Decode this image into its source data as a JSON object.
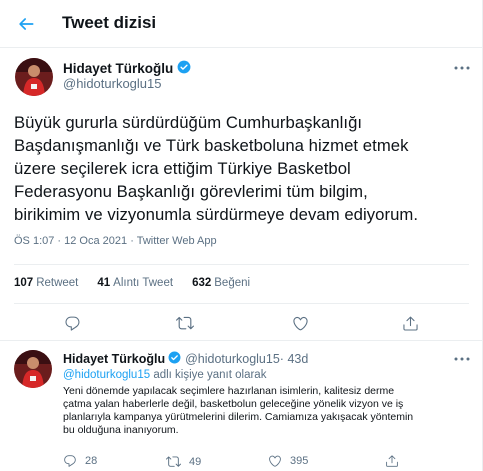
{
  "header": {
    "title": "Tweet dizisi"
  },
  "main_tweet": {
    "author_name": "Hidayet Türkoğlu",
    "author_handle": "@hidoturkoglu15",
    "text": "Büyük gururla sürdürdüğüm Cumhurbaşkanlığı\nBaşdanışmanlığı ve Türk basketboluna hizmet etmek\nüzere seçilerek icra ettiğim Türkiye Basketbol\nFederasyonu Başkanlığı görevlerimi tüm bilgim,\nbirikimim ve vizyonumla sürdürmeye devam ediyorum.",
    "time": "ÖS 1:07",
    "date": "12 Oca 2021",
    "source": "Twitter Web App",
    "stats": {
      "retweets_count": "107",
      "retweets_label": "Retweet",
      "quotes_count": "41",
      "quotes_label": "Alıntı Tweet",
      "likes_count": "632",
      "likes_label": "Beğeni"
    }
  },
  "reply_tweet": {
    "author_name": "Hidayet Türkoğlu",
    "author_handle": "@hidoturkoglu15",
    "time": "43d",
    "reply_to_mention": "@hidoturkoglu15",
    "reply_to_suffix": " adlı kişiye yanıt olarak",
    "text": "Yeni dönemde yapılacak seçimlere hazırlanan isimlerin, kalitesiz derme\nçatma yalan haberlerle değil, basketbolun geleceğine yönelik vizyon ve iş\nplanlarıyla kampanya yürütmelerini dilerim. Camiamıza yakışacak yöntemin\nbu olduğuna inanıyorum.",
    "reply_count": "28",
    "retweet_count": "49",
    "like_count": "395"
  },
  "colors": {
    "accent": "#1da1f2",
    "muted": "#5b7083",
    "divider": "#ebeef0",
    "text": "#0f1419"
  },
  "icons": [
    "back-arrow-icon",
    "verified-badge-icon",
    "more-icon",
    "reply-icon",
    "retweet-icon",
    "like-icon",
    "share-icon"
  ]
}
